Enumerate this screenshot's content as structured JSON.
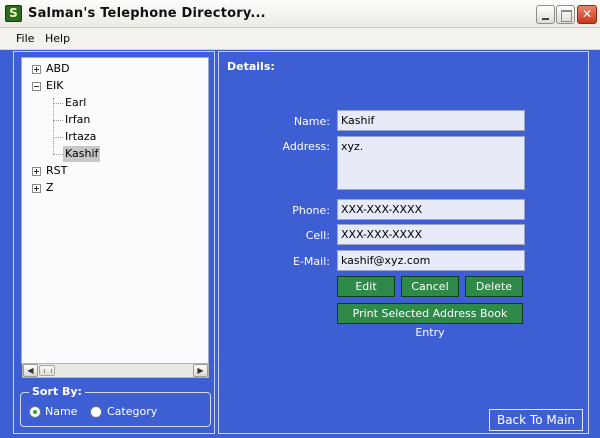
{
  "window": {
    "title": "Salman's Telephone Directory...",
    "app_icon_letter": "S",
    "close_glyph": "✕"
  },
  "menu": {
    "items": [
      {
        "label": "File"
      },
      {
        "label": "Help"
      }
    ]
  },
  "tree": {
    "groups": [
      {
        "label": "ABD",
        "expanded": false
      },
      {
        "label": "EIK",
        "expanded": true,
        "children": [
          "Earl",
          "Irfan",
          "Irtaza",
          "Kashif"
        ]
      },
      {
        "label": "RST",
        "expanded": false
      },
      {
        "label": "Z",
        "expanded": false
      }
    ],
    "selected": "Kashif"
  },
  "scrollbar": {
    "left_glyph": "◀",
    "right_glyph": "▶"
  },
  "sort": {
    "legend": "Sort By:",
    "options": [
      {
        "label": "Name",
        "checked": true
      },
      {
        "label": "Category",
        "checked": false
      }
    ]
  },
  "details": {
    "title": "Details:",
    "name_label": "Name:",
    "name_value": "Kashif",
    "address_label": "Address:",
    "address_value": "xyz.",
    "phone_label": "Phone:",
    "phone_value": "XXX-XXX-XXXX",
    "cell_label": "Cell:",
    "cell_value": "XXX-XXX-XXXX",
    "email_label": "E-Mail:",
    "email_value": "kashif@xyz.com",
    "edit_label": "Edit",
    "cancel_label": "Cancel",
    "delete_label": "Delete",
    "print_label": "Print Selected Address Book Entry",
    "back_label": "Back To Main"
  },
  "colors": {
    "panel_bg": "#3e5fd4",
    "button_green": "#2f8a4a",
    "field_bg": "#e7ebf7"
  }
}
